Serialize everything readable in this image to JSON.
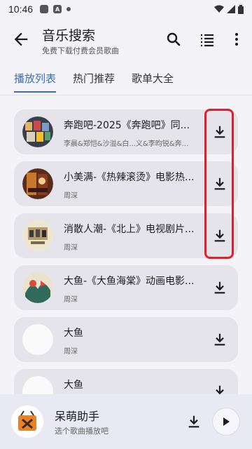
{
  "status": {
    "time": "10:46"
  },
  "appbar": {
    "title": "音乐搜索",
    "subtitle": "免费下载付费会员歌曲"
  },
  "tabs": [
    {
      "label": "播放列表",
      "active": true
    },
    {
      "label": "热门推荐",
      "active": false
    },
    {
      "label": "歌单大全",
      "active": false
    }
  ],
  "songs": [
    {
      "title": "奔跑吧-2025《奔跑吧》同...",
      "artist": "李晨&郑恺&沙溢&白...义&李昀锐&奔跑吧"
    },
    {
      "title": "小美满-《热辣滚烫》电影热...",
      "artist": "周深"
    },
    {
      "title": "消散人潮-《北上》电视剧片...",
      "artist": "周深"
    },
    {
      "title": "大鱼-《大鱼海棠》动画电影...",
      "artist": "周深"
    },
    {
      "title": "大鱼",
      "artist": "周深"
    },
    {
      "title": "大鱼",
      "artist": ""
    }
  ],
  "player": {
    "title": "呆萌助手",
    "subtitle": "选个歌曲播放吧"
  },
  "colors": {
    "accent": "#3f6fb5",
    "highlight": "#e0202c",
    "card": "#e5e4ea",
    "player_bg": "#e8e9f2"
  }
}
